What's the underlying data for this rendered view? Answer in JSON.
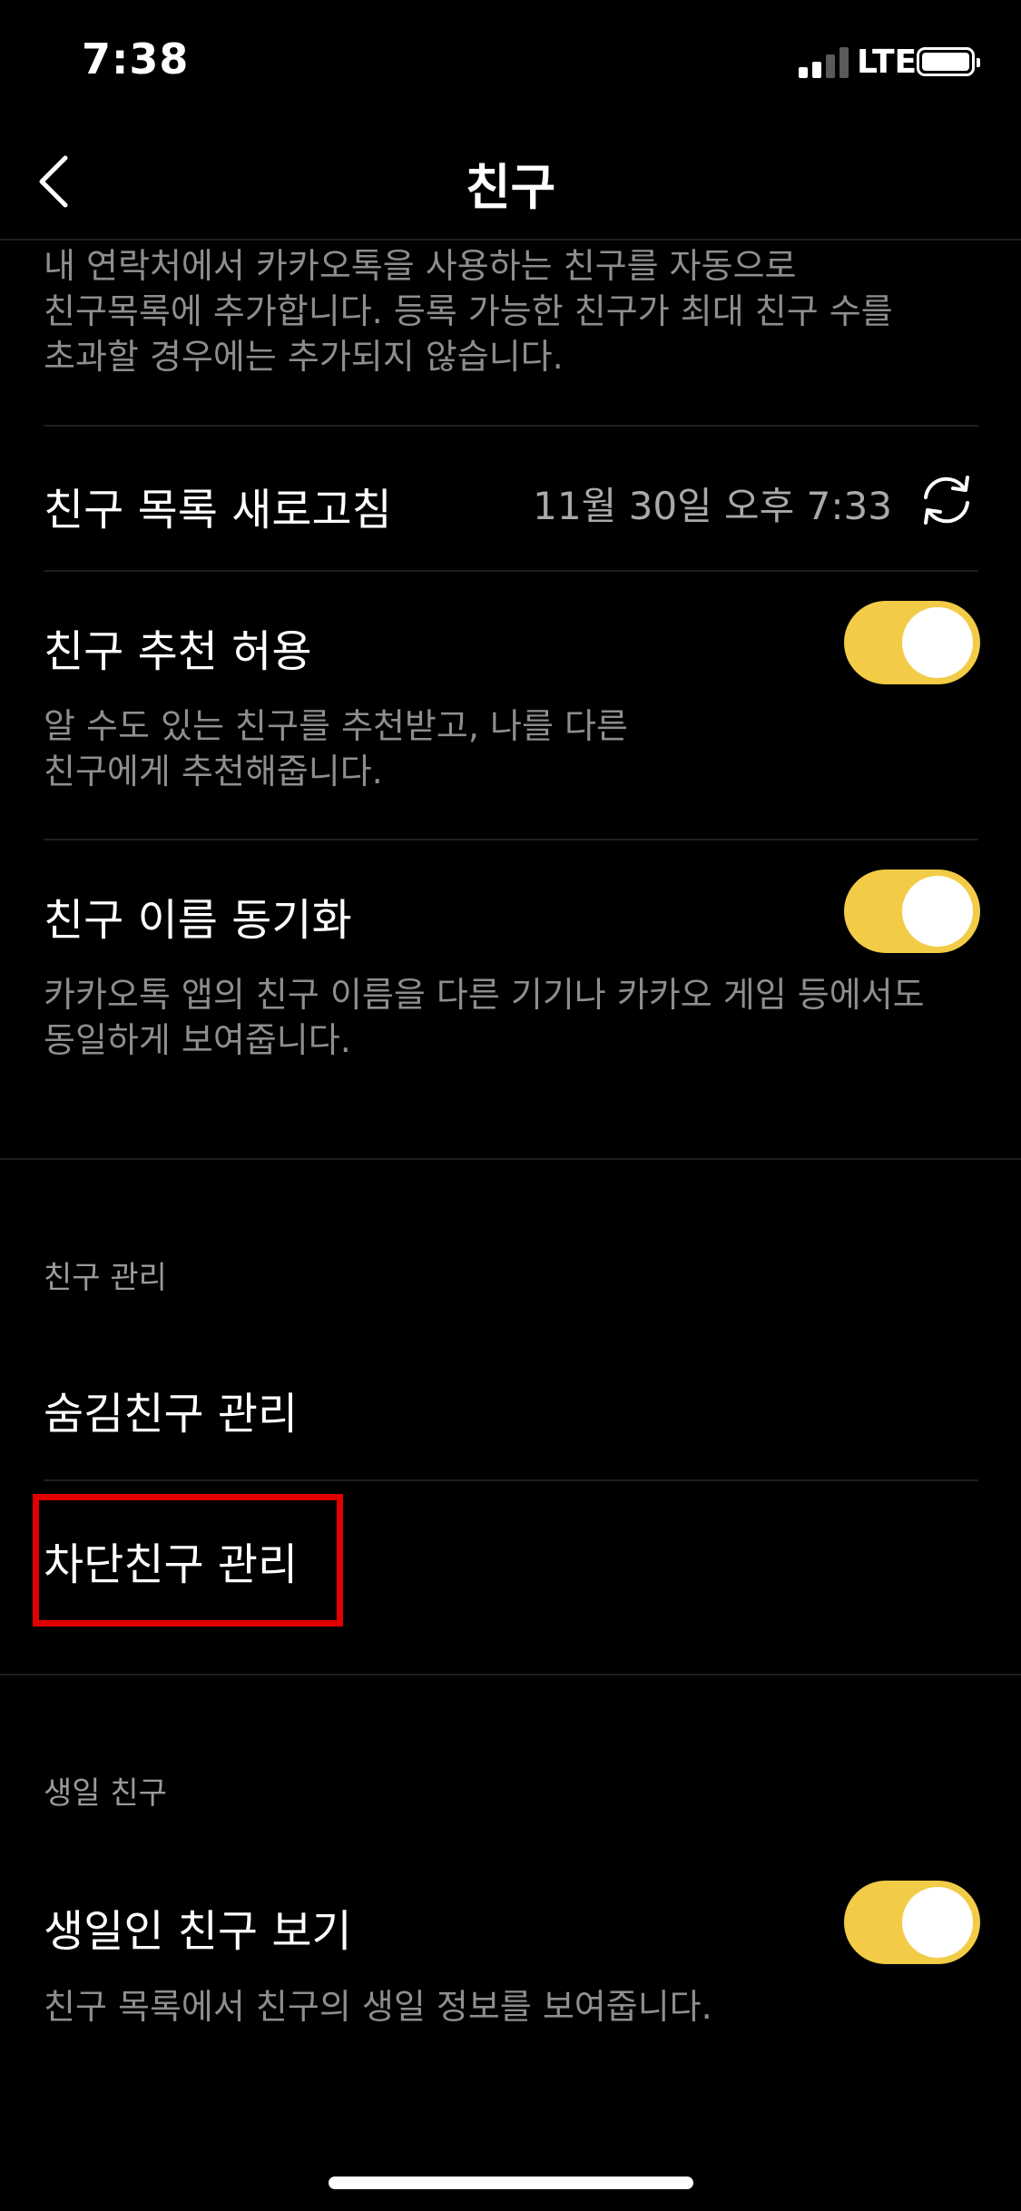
{
  "status_bar": {
    "time": "7:38",
    "network": "LTE",
    "signal_bars": 2
  },
  "nav": {
    "title": "친구",
    "back_icon": "chevron-left-icon"
  },
  "auto_add": {
    "description_lines": [
      "내 연락처에서 카카오톡을 사용하는 친구를 자동으로",
      "친구목록에 추가합니다. 등록 가능한 친구가 최대 친구 수를",
      "초과할 경우에는 추가되지 않습니다."
    ]
  },
  "refresh": {
    "label": "친구 목록 새로고침",
    "timestamp": "11월 30일 오후 7:33",
    "icon": "refresh-icon"
  },
  "recommend": {
    "label": "친구 추천 허용",
    "enabled": true,
    "description_lines": [
      "알 수도 있는 친구를 추천받고, 나를 다른",
      "친구에게 추천해줍니다."
    ]
  },
  "name_sync": {
    "label": "친구 이름 동기화",
    "enabled": true,
    "description_lines": [
      "카카오톡 앱의 친구 이름을 다른 기기나 카카오 게임 등에서도",
      "동일하게 보여줍니다."
    ]
  },
  "manage_section": {
    "header": "친구 관리",
    "hidden_friends": "숨김친구 관리",
    "blocked_friends": "차단친구 관리"
  },
  "birthday_section": {
    "header": "생일 친구",
    "label": "생일인 친구 보기",
    "enabled": true,
    "description": "친구 목록에서 친구의 생일 정보를 보여줍니다."
  },
  "colors": {
    "toggle_on": "#f2cc47",
    "highlight": "#e00000",
    "background": "#000000"
  }
}
